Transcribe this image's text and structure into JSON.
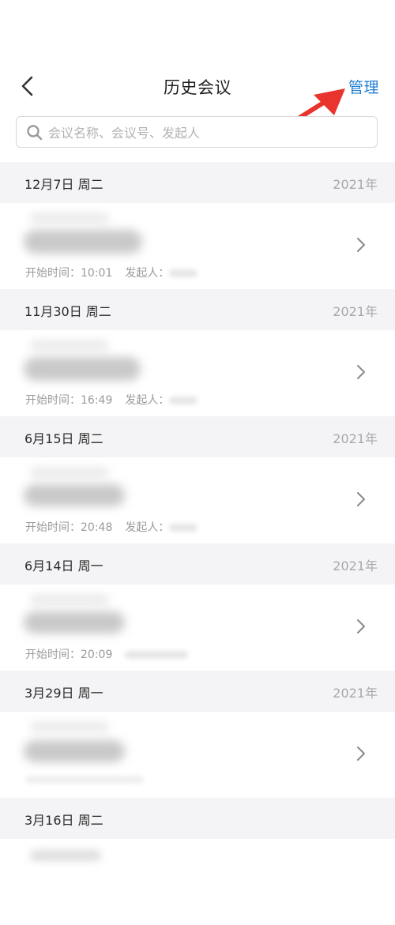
{
  "nav": {
    "title": "历史会议",
    "manage_label": "管理"
  },
  "search": {
    "placeholder": "会议名称、会议号、发起人"
  },
  "colors": {
    "accent": "#1f7fd1",
    "annotation_arrow": "#e8342c",
    "section_bg": "#f4f4f6"
  },
  "groups": [
    {
      "date": "12月7日 周二",
      "year": "2021年",
      "time_label": "开始时间：10:01",
      "initiator_label": "发起人："
    },
    {
      "date": "11月30日 周二",
      "year": "2021年",
      "time_label": "开始时间：16:49",
      "initiator_label": "发起人："
    },
    {
      "date": "6月15日 周二",
      "year": "2021年",
      "time_label": "开始时间：20:48",
      "initiator_label": "发起人："
    },
    {
      "date": "6月14日 周一",
      "year": "2021年",
      "time_label": "开始时间：20:09",
      "initiator_label": ""
    },
    {
      "date": "3月29日 周一",
      "year": "2021年",
      "time_label": "",
      "initiator_label": ""
    },
    {
      "date": "3月16日 周二",
      "year": "",
      "time_label": "",
      "initiator_label": ""
    }
  ]
}
